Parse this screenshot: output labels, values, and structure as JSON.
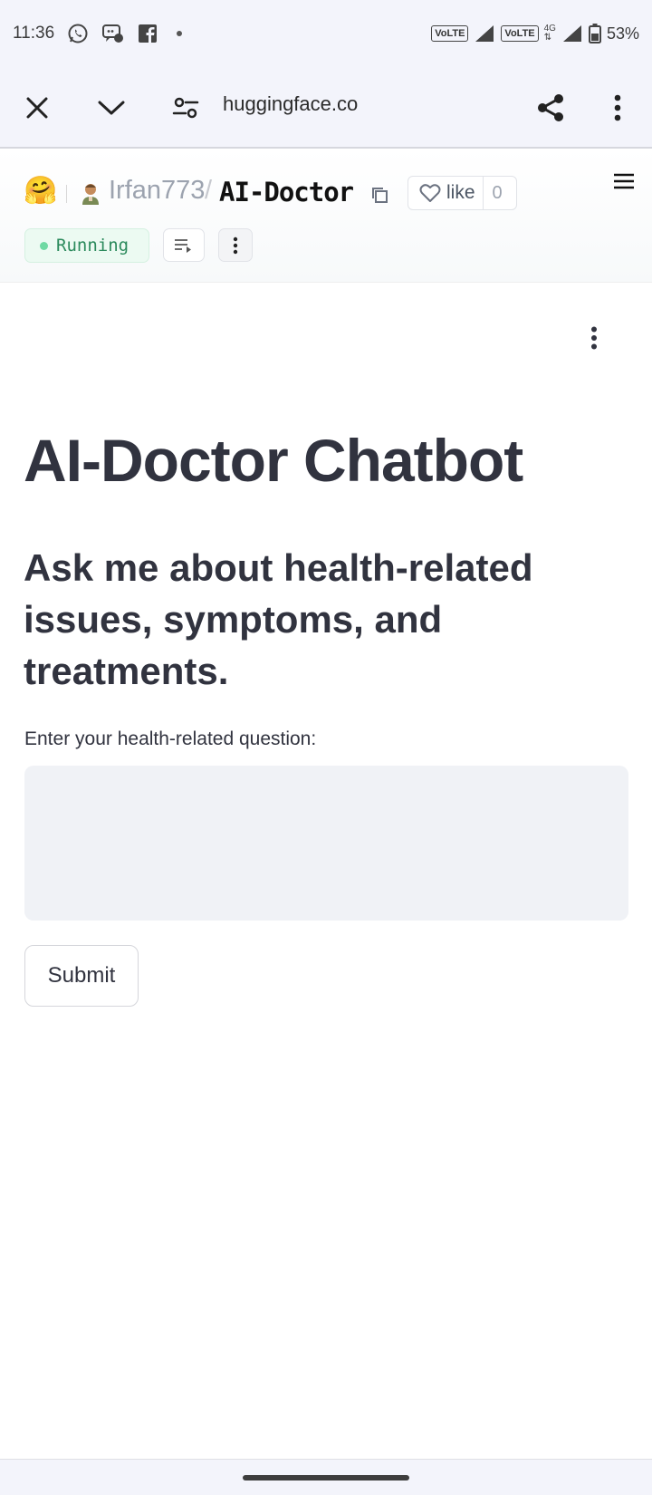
{
  "status_bar": {
    "time": "11:36",
    "notification_icons": [
      "whatsapp-icon",
      "chat-icon",
      "facebook-icon",
      "dot-icon"
    ],
    "volte_1": "VoLTE",
    "volte_2": "VoLTE",
    "network_type": "4G",
    "battery": "53%"
  },
  "browser": {
    "url": "huggingface.co",
    "icons": [
      "close-icon",
      "chevron-down-icon",
      "site-settings-icon",
      "share-icon",
      "more-vert-icon"
    ]
  },
  "space_header": {
    "owner": "Irfan773",
    "separator": "/",
    "repo": "AI-Doctor",
    "like_label": "like",
    "like_count": "0",
    "status": "Running",
    "status_color": "#2b8a5c"
  },
  "app": {
    "title": "AI-Doctor Chatbot",
    "subtitle": "Ask me about health-related issues, symptoms, and treatments.",
    "input_label": "Enter your health-related question:",
    "input_value": "",
    "submit_label": "Submit"
  },
  "colors": {
    "text": "#31333f",
    "input_bg": "#f0f2f6",
    "chrome_bg": "#f3f4fb"
  }
}
